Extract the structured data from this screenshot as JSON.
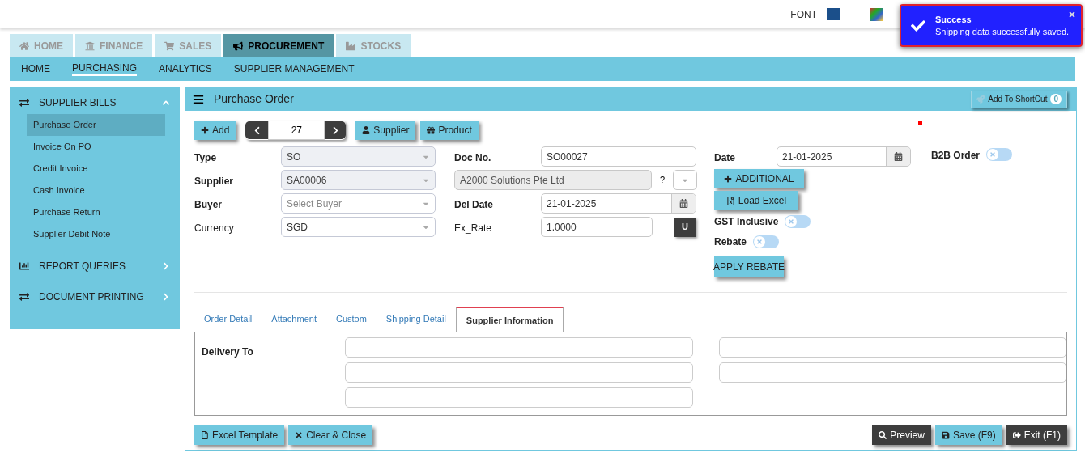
{
  "header": {
    "font_label": "FONT"
  },
  "toast": {
    "title": "Success",
    "message": "Shipping data successfully saved."
  },
  "module_tabs": [
    {
      "label": "HOME",
      "selected": false
    },
    {
      "label": "FINANCE",
      "selected": false
    },
    {
      "label": "SALES",
      "selected": false
    },
    {
      "label": "PROCUREMENT",
      "selected": true
    },
    {
      "label": "STOCKS",
      "selected": false
    }
  ],
  "sub_nav": [
    {
      "label": "HOME",
      "selected": false
    },
    {
      "label": "PURCHASING",
      "selected": true
    },
    {
      "label": "ANALYTICS",
      "selected": false
    },
    {
      "label": "SUPPLIER MANAGEMENT",
      "selected": false
    }
  ],
  "sidebar": {
    "sections": [
      {
        "title": "SUPPLIER BILLS",
        "expanded": true,
        "items": [
          {
            "label": "Purchase Order",
            "selected": true
          },
          {
            "label": "Invoice On PO",
            "selected": false
          },
          {
            "label": "Credit Invoice",
            "selected": false
          },
          {
            "label": "Cash Invoice",
            "selected": false
          },
          {
            "label": "Purchase Return",
            "selected": false
          },
          {
            "label": "Supplier Debit Note",
            "selected": false
          }
        ]
      },
      {
        "title": "REPORT QUERIES",
        "expanded": false
      },
      {
        "title": "DOCUMENT PRINTING",
        "expanded": false
      }
    ]
  },
  "panel": {
    "title": "Purchase Order",
    "shortcut": {
      "label": "Add To ShortCut",
      "count": "0"
    }
  },
  "toolbar": {
    "add": "Add",
    "record": "27",
    "supplier": "Supplier",
    "product": "Product"
  },
  "form": {
    "type": {
      "label": "Type",
      "value": "SO"
    },
    "supplier": {
      "label": "Supplier",
      "value": "SA00006"
    },
    "buyer": {
      "label": "Buyer",
      "placeholder": "Select Buyer"
    },
    "currency": {
      "label": "Currency",
      "value": "SGD"
    },
    "doc_no": {
      "label": "Doc No.",
      "value": "SO00027"
    },
    "supplier_name": {
      "value": "A2000 Solutions Pte Ltd",
      "help": "?"
    },
    "del_date": {
      "label": "Del Date",
      "value": "21-01-2025"
    },
    "ex_rate": {
      "label": "Ex_Rate",
      "value": "1.0000",
      "button": "U"
    },
    "date": {
      "label": "Date",
      "value": "21-01-2025"
    },
    "additional": "ADDITIONAL",
    "load_excel": "Load Excel",
    "gst_inclusive": {
      "label": "GST Inclusive",
      "on": false
    },
    "rebate": {
      "label": "Rebate",
      "on": false
    },
    "apply_rebate": "APPLY REBATE",
    "b2b_order": {
      "label": "B2B Order",
      "on": false
    }
  },
  "tabs": [
    {
      "label": "Order Detail",
      "selected": false
    },
    {
      "label": "Attachment",
      "selected": false
    },
    {
      "label": "Custom",
      "selected": false
    },
    {
      "label": "Shipping Detail",
      "selected": false
    },
    {
      "label": "Supplier Information",
      "selected": true
    }
  ],
  "supplier_info": {
    "label": "Delivery To"
  },
  "footer": {
    "excel_template": "Excel Template",
    "clear_close": "Clear & Close",
    "preview": "Preview",
    "save": "Save (F9)",
    "exit": "Exit (F1)"
  }
}
